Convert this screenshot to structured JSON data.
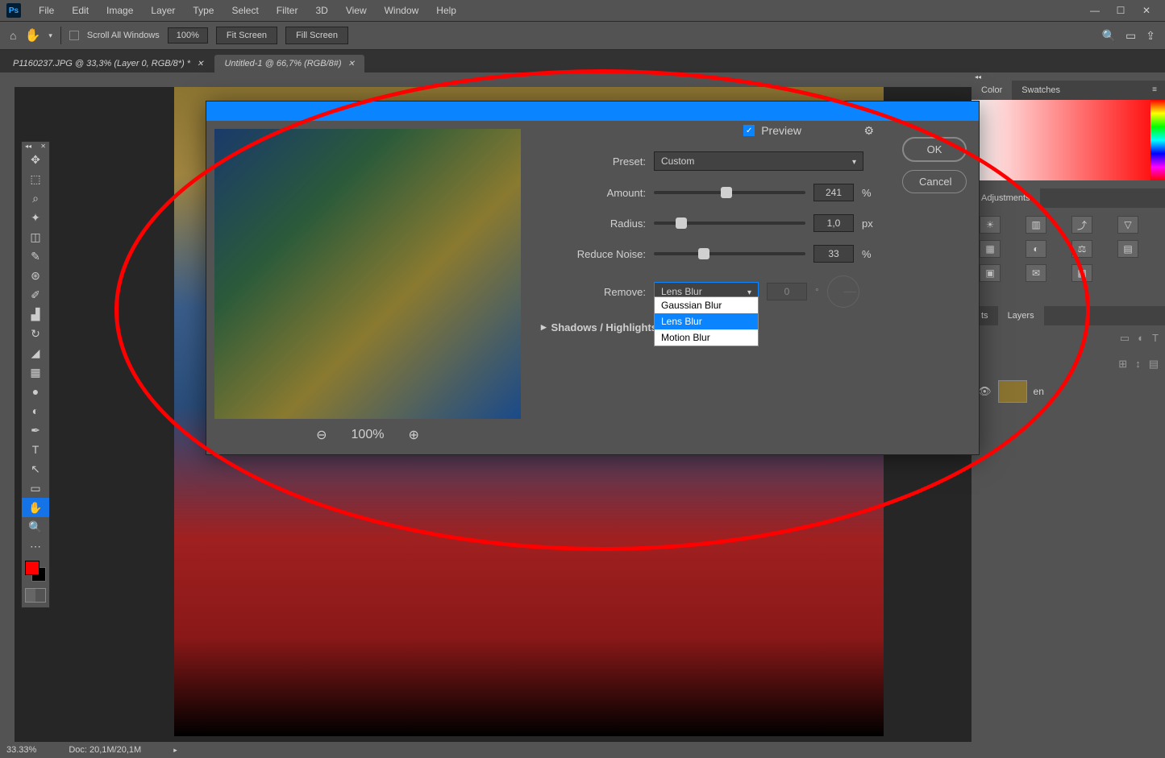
{
  "menu": {
    "items": [
      "File",
      "Edit",
      "Image",
      "Layer",
      "Type",
      "Select",
      "Filter",
      "3D",
      "View",
      "Window",
      "Help"
    ]
  },
  "options_bar": {
    "scroll_all_label": "Scroll All Windows",
    "zoom_value": "100%",
    "fit_screen": "Fit Screen",
    "fill_screen": "Fill Screen"
  },
  "tabs": [
    {
      "label": "P1160237.JPG @ 33,3% (Layer 0, RGB/8*) *",
      "active": true
    },
    {
      "label": "Untitled-1 @ 66,7% (RGB/8#)",
      "active": false
    }
  ],
  "status": {
    "zoom": "33.33%",
    "doc": "Doc: 20,1M/20,1M"
  },
  "panels": {
    "color_tab": "Color",
    "swatches_tab": "Swatches",
    "adjustments_tab": "Adjustments",
    "layers_tab": "Layers"
  },
  "dialog": {
    "preview_label": "Preview",
    "preset_label": "Preset:",
    "preset_value": "Custom",
    "amount_label": "Amount:",
    "amount_value": "241",
    "amount_unit": "%",
    "radius_label": "Radius:",
    "radius_value": "1,0",
    "radius_unit": "px",
    "noise_label": "Reduce Noise:",
    "noise_value": "33",
    "noise_unit": "%",
    "remove_label": "Remove:",
    "remove_value": "Lens Blur",
    "remove_options": [
      "Gaussian Blur",
      "Lens Blur",
      "Motion Blur"
    ],
    "angle_value": "0",
    "shadows_label": "Shadows / Highlights",
    "preview_zoom": "100%",
    "ok": "OK",
    "cancel": "Cancel"
  }
}
